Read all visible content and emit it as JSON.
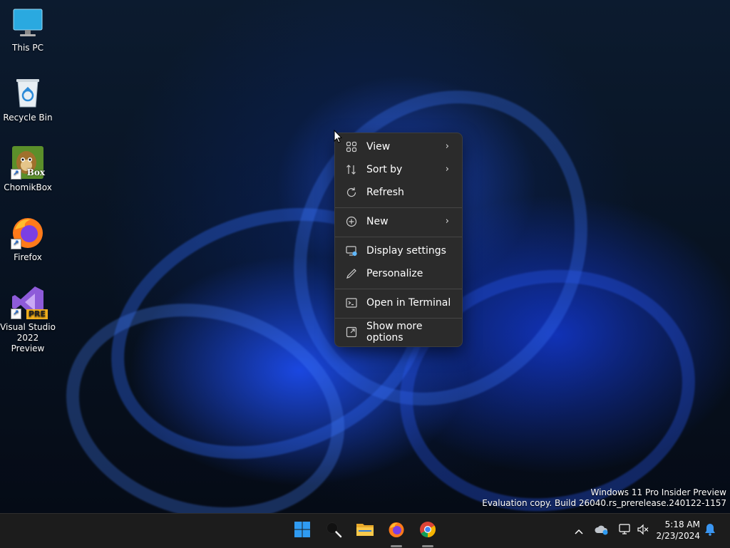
{
  "desktop": {
    "icons": [
      {
        "label": "This PC"
      },
      {
        "label": "Recycle Bin"
      },
      {
        "label": "ChomikBox",
        "badge": "Box"
      },
      {
        "label": "Firefox"
      },
      {
        "label": "Visual Studio 2022 Preview",
        "badge": "PRE"
      }
    ]
  },
  "context_menu": {
    "items": [
      {
        "label": "View",
        "icon": "grid-icon",
        "submenu": true
      },
      {
        "label": "Sort by",
        "icon": "sort-icon",
        "submenu": true
      },
      {
        "label": "Refresh",
        "icon": "refresh-icon"
      },
      {
        "label": "New",
        "icon": "plus-circle-icon",
        "submenu": true
      },
      {
        "label": "Display settings",
        "icon": "display-settings-icon"
      },
      {
        "label": "Personalize",
        "icon": "pen-icon"
      },
      {
        "label": "Open in Terminal",
        "icon": "terminal-icon"
      },
      {
        "label": "Show more options",
        "icon": "expand-icon"
      }
    ],
    "chevron": "›"
  },
  "watermark": {
    "line1": "Windows 11 Pro Insider Preview",
    "line2": "Evaluation copy. Build 26040.rs_prerelease.240122-1157"
  },
  "taskbar": {
    "apps": [
      "start-icon",
      "search-icon",
      "file-explorer-icon",
      "firefox-icon",
      "chrome-icon"
    ],
    "tray": [
      "chevron-up-icon",
      "onedrive-icon",
      "network-icon",
      "volume-muted-icon"
    ],
    "time": "5:18 AM",
    "date": "2/23/2024"
  },
  "colors": {
    "menu_bg": "#2b2b2b",
    "taskbar_bg": "#1c1c1c",
    "accent": "#0078d4"
  }
}
